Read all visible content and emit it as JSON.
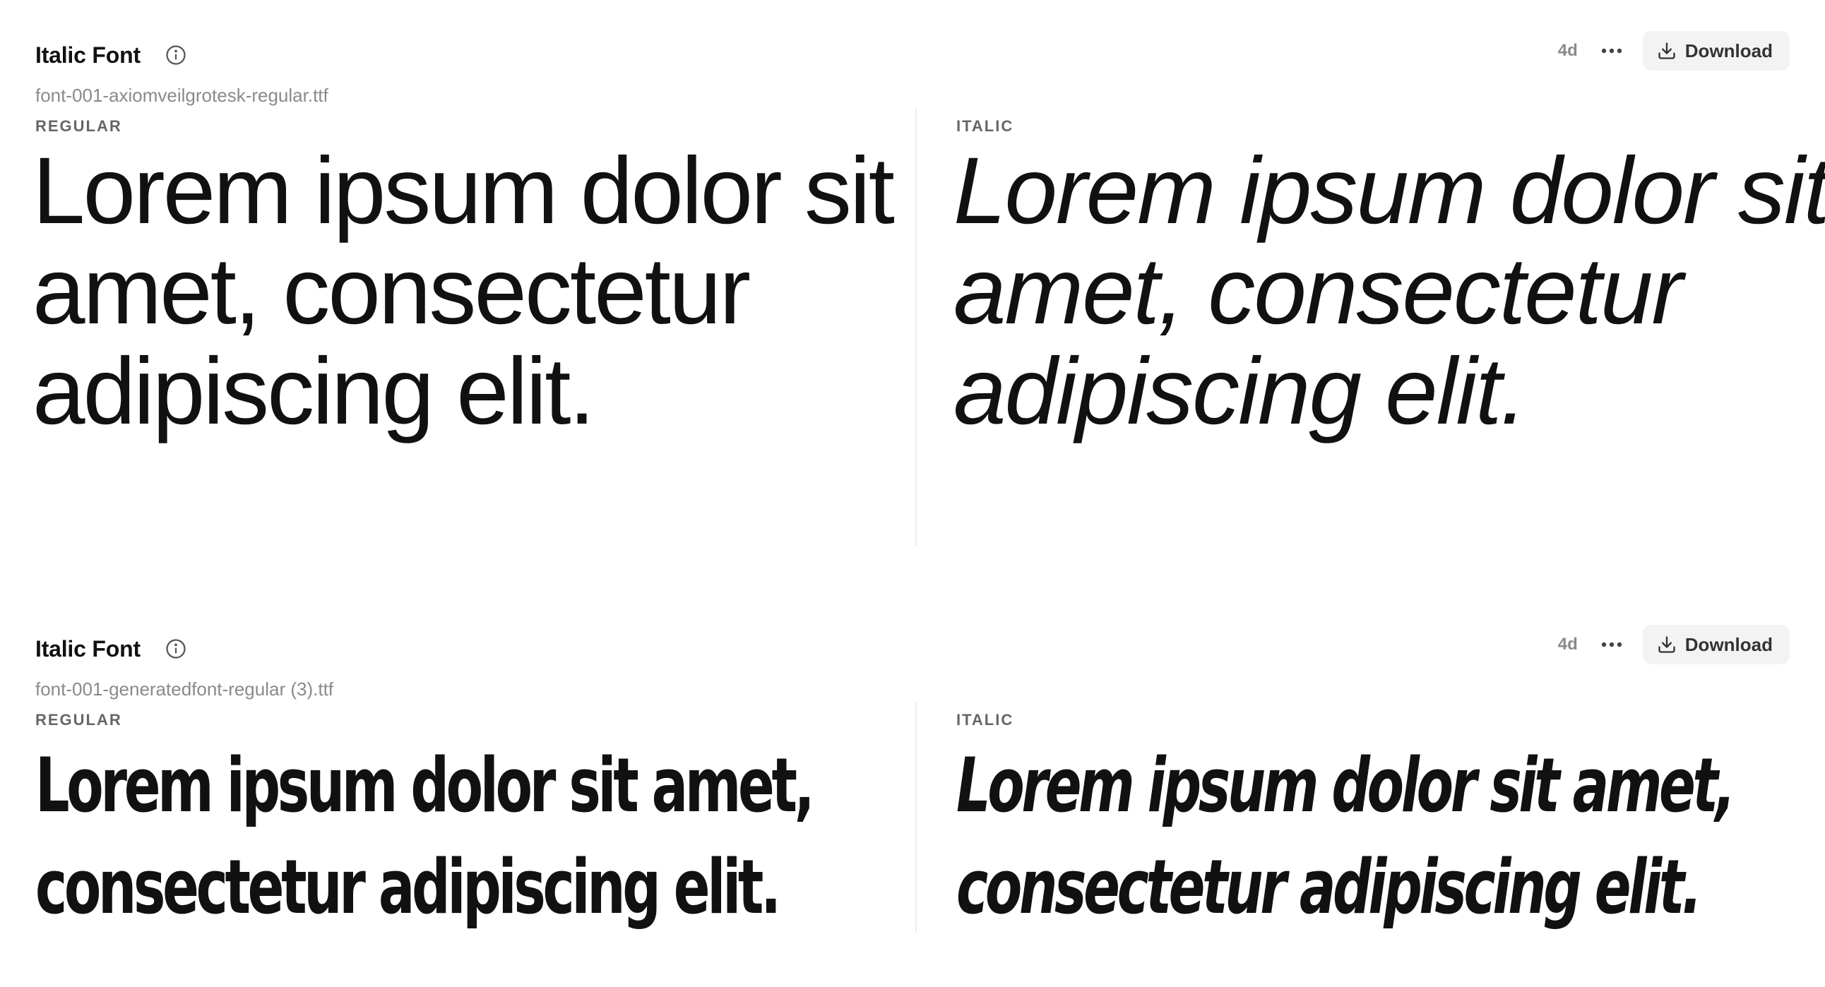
{
  "cards": [
    {
      "title": "Italic Font",
      "filename": "font-001-axiomveilgrotesk-regular.ttf",
      "age": "4d",
      "download_label": "Download",
      "regular_label": "REGULAR",
      "italic_label": "ITALIC",
      "regular_sample": "Lorem ipsum dolor sit amet, consectetur adipiscing elit.",
      "italic_sample": "Lorem ipsum dolor sit amet, consectetur adipiscing elit."
    },
    {
      "title": "Italic Font",
      "filename": "font-001-generatedfont-regular (3).ttf",
      "age": "4d",
      "download_label": "Download",
      "regular_label": "REGULAR",
      "italic_label": "ITALIC",
      "regular_sample": "Lorem ipsum dolor sit amet, consectetur adipiscing elit.",
      "italic_sample": "Lorem ipsum dolor sit amet, consectetur adipiscing elit."
    }
  ],
  "icons": {
    "info": "info-icon",
    "more": "more-horizontal-icon",
    "download": "download-icon"
  },
  "colors": {
    "text": "#111111",
    "muted": "#8a8a8a",
    "button_bg": "#f3f3f3",
    "divider": "#ececec"
  }
}
